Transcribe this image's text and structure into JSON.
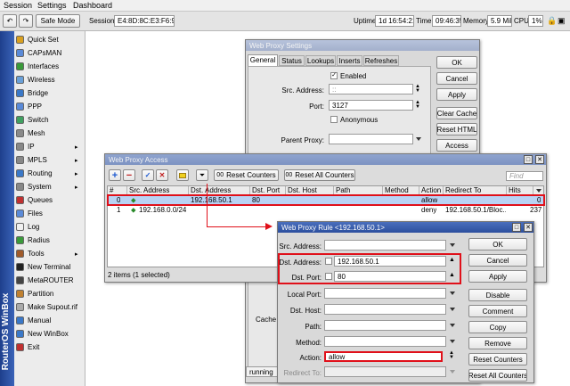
{
  "menubar": {
    "items": [
      "Session",
      "Settings",
      "Dashboard"
    ]
  },
  "toolbar": {
    "safe_mode": "Safe Mode",
    "session_label": "Session:",
    "session_value": "E4:8D:8C:E3:F6:9F",
    "uptime_label": "Uptime:",
    "uptime_value": "1d 16:54:21",
    "time_label": "Time:",
    "time_value": "09:46:35",
    "memory_label": "Memory:",
    "memory_value": "5.9 MiB",
    "cpu_label": "CPU:",
    "cpu_value": "1%"
  },
  "sidebar": {
    "vertical_label": "RouterOS WinBox",
    "items": [
      {
        "label": "Quick Set",
        "color": "#d9a020"
      },
      {
        "label": "CAPsMAN",
        "color": "#5a8ad8"
      },
      {
        "label": "Interfaces",
        "color": "#3a9a3a"
      },
      {
        "label": "Wireless",
        "color": "#6aa0d8"
      },
      {
        "label": "Bridge",
        "color": "#3a78c8"
      },
      {
        "label": "PPP",
        "color": "#5a8ad8"
      },
      {
        "label": "Switch",
        "color": "#40a060"
      },
      {
        "label": "Mesh",
        "color": "#8a8a8a"
      },
      {
        "label": "IP",
        "color": "#888888",
        "submenu": "▸"
      },
      {
        "label": "MPLS",
        "color": "#888888",
        "submenu": "▸"
      },
      {
        "label": "Routing",
        "color": "#3a78c8",
        "submenu": "▸"
      },
      {
        "label": "System",
        "color": "#888888",
        "submenu": "▸"
      },
      {
        "label": "Queues",
        "color": "#c03030"
      },
      {
        "label": "Files",
        "color": "#5a8ad8"
      },
      {
        "label": "Log",
        "color": "#f0f0f0"
      },
      {
        "label": "Radius",
        "color": "#3a9a3a"
      },
      {
        "label": "Tools",
        "color": "#a05a2a",
        "submenu": "▸"
      },
      {
        "label": "New Terminal",
        "color": "#222222"
      },
      {
        "label": "MetaROUTER",
        "color": "#444444"
      },
      {
        "label": "Partition",
        "color": "#c08030"
      },
      {
        "label": "Make Supout.rif",
        "color": "#aaaaaa"
      },
      {
        "label": "Manual",
        "color": "#3a78c8"
      },
      {
        "label": "New WinBox",
        "color": "#3a78c8"
      },
      {
        "label": "Exit",
        "color": "#c03030"
      }
    ]
  },
  "proxy_settings": {
    "title": "Web Proxy Settings",
    "tabs": [
      "General",
      "Status",
      "Lookups",
      "Inserts",
      "Refreshes"
    ],
    "enabled_label": "Enabled",
    "src_address_label": "Src. Address:",
    "src_address_value": "::",
    "port_label": "Port:",
    "port_value": "3127",
    "anonymous_label": "Anonymous",
    "parent_proxy_label": "Parent Proxy:",
    "cache_label": "Cache",
    "status": "running",
    "buttons": [
      "OK",
      "Cancel",
      "Apply",
      "Clear Cache",
      "Reset HTML",
      "Access"
    ]
  },
  "proxy_access": {
    "title": "Web Proxy Access",
    "reset_counters": "Reset Counters",
    "reset_all_counters": "Reset All Counters",
    "find_placeholder": "Find",
    "columns": [
      "#",
      "Src. Address",
      "Dst. Address",
      "Dst. Port",
      "Dst. Host",
      "Path",
      "Method",
      "Action",
      "Redirect To",
      "Hits"
    ],
    "rows": [
      {
        "num": "0",
        "src": "",
        "dst": "192.168.50.1",
        "port": "80",
        "host": "",
        "path": "",
        "method": "",
        "action": "allow",
        "redirect": "",
        "hits": "0"
      },
      {
        "num": "1",
        "src": "192.168.0.0/24",
        "dst": "",
        "port": "",
        "host": "",
        "path": "",
        "method": "",
        "action": "deny",
        "redirect": "192.168.50.1/Bloc...",
        "hits": "237"
      }
    ],
    "status": "2 items (1 selected)"
  },
  "proxy_rule": {
    "title": "Web Proxy Rule <192.168.50.1>",
    "src_address_label": "Src. Address:",
    "dst_address_label": "Dst. Address:",
    "dst_address_value": "192.168.50.1",
    "dst_port_label": "Dst. Port:",
    "dst_port_value": "80",
    "local_port_label": "Local Port:",
    "dst_host_label": "Dst. Host:",
    "path_label": "Path:",
    "method_label": "Method:",
    "action_label": "Action:",
    "action_value": "allow",
    "redirect_label": "Redirect To:",
    "buttons": [
      "OK",
      "Cancel",
      "Apply",
      "Disable",
      "Comment",
      "Copy",
      "Remove",
      "Reset Counters",
      "Reset All Counters"
    ]
  },
  "colors": {
    "highlight": "#e0101a",
    "selected_row": "#b9d3f4",
    "titlebar": "#2c4f9e"
  }
}
